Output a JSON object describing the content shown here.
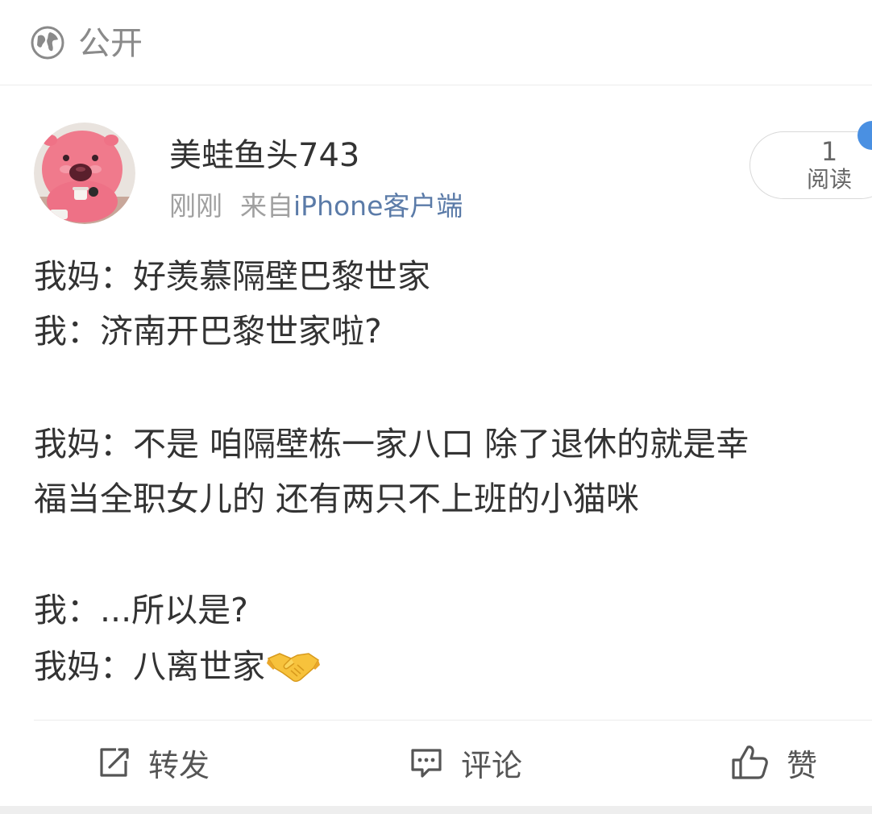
{
  "visibility": {
    "label": "公开",
    "icon": "globe-icon"
  },
  "post": {
    "author": "美蛙鱼头743",
    "time": "刚刚",
    "source_prefix": "来自",
    "source_device": "iPhone客户端",
    "read_count": "1",
    "read_label": "阅读",
    "lines": [
      "我妈：好羡慕隔壁巴黎世家",
      "我：济南开巴黎世家啦?",
      "",
      "我妈：不是 咱隔壁栋一家八口 除了退休的就是幸",
      "福当全职女儿的 还有两只不上班的小猫咪",
      "",
      "我：...所以是?",
      "我妈：八离世家"
    ],
    "emoji": "handshake"
  },
  "actions": {
    "repost": "转发",
    "comment": "评论",
    "like": "赞"
  },
  "colors": {
    "link": "#5b7ba8",
    "muted": "#a0a0a0",
    "text": "#333333",
    "badge": "#4a90e2"
  }
}
